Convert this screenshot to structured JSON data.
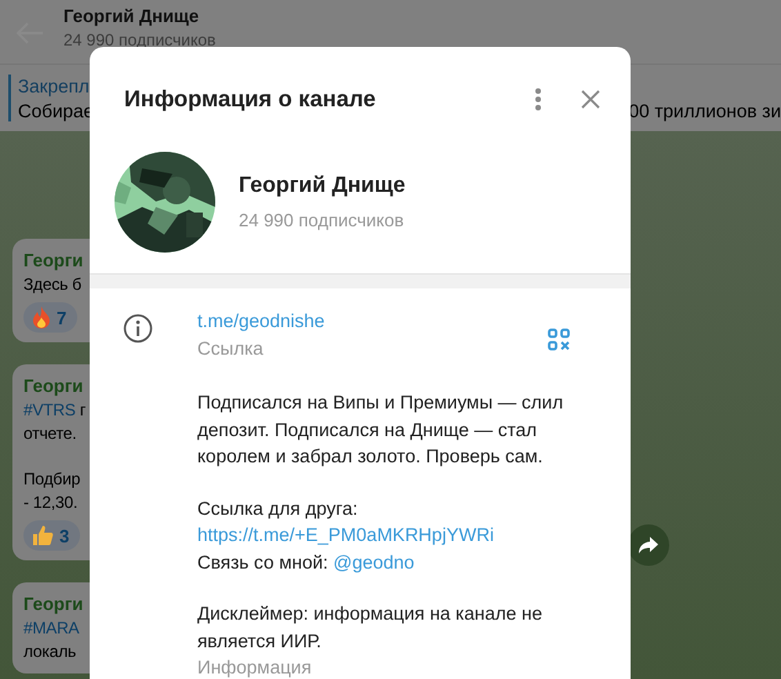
{
  "chat_header": {
    "title": "Георгий Днище",
    "subtitle": "24 990 подписчиков"
  },
  "pinned": {
    "label": "Закрепл",
    "text": "Собирае",
    "text_right": "00 триллионов зи"
  },
  "messages": [
    {
      "author": "Георги",
      "paragraphs": [
        [
          {
            "parts": [
              {
                "kind": "text",
                "text": "Здесь б"
              }
            ]
          }
        ]
      ],
      "reactions": [
        {
          "kind": "fire",
          "count": "7"
        }
      ]
    },
    {
      "author": "Георги",
      "paragraphs": [
        [
          {
            "parts": [
              {
                "kind": "hashtag",
                "text": "#VTRS"
              },
              {
                "kind": "text",
                "text": " г"
              }
            ]
          },
          {
            "parts": [
              {
                "kind": "text",
                "text": "отчете."
              }
            ]
          }
        ],
        [
          {
            "parts": [
              {
                "kind": "text",
                "text": "Подбир"
              }
            ]
          },
          {
            "parts": [
              {
                "kind": "text",
                "text": "- 12,30."
              }
            ]
          }
        ]
      ],
      "reactions": [
        {
          "kind": "thumbs_up",
          "count": "3"
        }
      ]
    },
    {
      "author": "Георги",
      "paragraphs": [
        [
          {
            "parts": [
              {
                "kind": "hashtag",
                "text": "#MARA"
              }
            ]
          },
          {
            "parts": [
              {
                "kind": "text",
                "text": "локаль"
              }
            ]
          }
        ]
      ]
    }
  ],
  "channel_info": {
    "title": "Информация о канале",
    "name": "Георгий Днище",
    "subscribers": "24 990 подписчиков",
    "link": {
      "value": "t.me/geodnishe",
      "caption": "Ссылка"
    },
    "description": {
      "intro": "Подписался на Випы и Премиумы — слил\nдепозит. Подписался на Днище — стал\nкоролем и забрал золото. Проверь сам.",
      "friend_label": "Ссылка для друга:",
      "friend_link": "https://t.me/+E_PM0aMKRHpjYWRi",
      "contact_label": "Связь со мной:",
      "contact_handle": "@geodno",
      "disclaimer": "Дисклеймер: информация на канале не\nявляется ИИР.",
      "caption": "Информация"
    }
  }
}
